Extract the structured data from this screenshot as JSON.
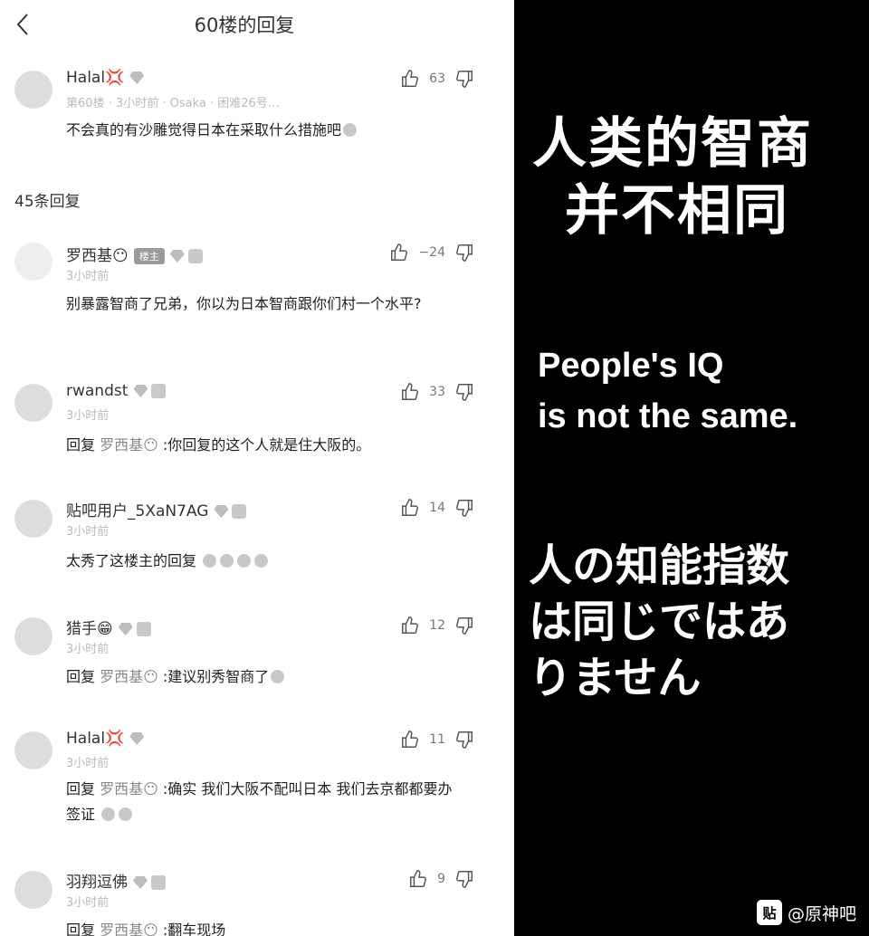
{
  "header": {
    "title": "60楼的回复"
  },
  "main_post": {
    "username": "Halal💢",
    "likes": "63",
    "meta": "第60楼 · 3小时前 · Osaka · 困难26号…",
    "text": "不会真的有沙雕觉得日本在采取什么措施吧"
  },
  "reply_count": "45条回复",
  "replies": [
    {
      "username": "罗西基😶",
      "owner_badge": "楼主",
      "likes": "−24",
      "time": "3小时前",
      "text": "别暴露智商了兄弟，你以为日本智商跟你们村一个水平?"
    },
    {
      "username": "rwandst",
      "likes": "33",
      "time": "3小时前",
      "reply_prefix": "回复",
      "reply_target": "罗西基😶",
      "text": ":你回复的这个人就是住大阪的。"
    },
    {
      "username": "贴吧用户_5XaN7AG",
      "likes": "14",
      "time": "3小时前",
      "text": "太秀了这楼主的回复"
    },
    {
      "username": "猎手😁",
      "likes": "12",
      "time": "3小时前",
      "reply_prefix": "回复",
      "reply_target": "罗西基😶",
      "text": ":建议别秀智商了"
    },
    {
      "username": "Halal💢",
      "likes": "11",
      "time": "3小时前",
      "reply_prefix": "回复",
      "reply_target": "罗西基😶",
      "text": ":确实 我们大阪不配叫日本 我们去京都都要办签证"
    },
    {
      "username": "羽翔逗佛",
      "likes": "9",
      "time": "3小时前",
      "reply_prefix": "回复",
      "reply_target": "罗西基😶",
      "text": ":翻车现场"
    }
  ],
  "captions": {
    "cn_line1": "人类的智商",
    "cn_line2": "并不相同",
    "en_line1": "People's IQ",
    "en_line2": "is not the same.",
    "jp_line1": "人の知能指数",
    "jp_line2": "は同じではあ",
    "jp_line3": "りません"
  },
  "watermark": {
    "logo": "贴",
    "text": "@原神吧"
  },
  "icons": {
    "back": "chevron-left-icon",
    "like": "thumbs-up-icon",
    "dislike": "thumbs-down-icon"
  }
}
